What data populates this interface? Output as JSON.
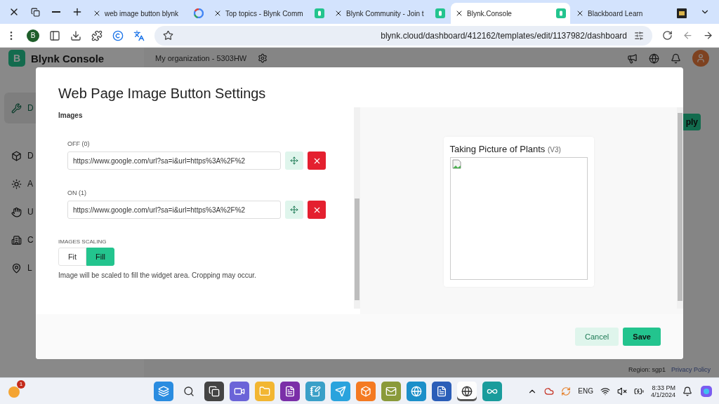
{
  "browser": {
    "tabs": [
      {
        "title": "web image button blynk",
        "selected": false
      },
      {
        "title": "Top topics - Blynk Comm",
        "selected": false
      },
      {
        "title": "Blynk Community - Join t",
        "selected": false
      },
      {
        "title": "Blynk.Console",
        "selected": true
      },
      {
        "title": "Blackboard Learn",
        "selected": false
      }
    ],
    "profile_initial": "B",
    "url": "blynk.cloud/dashboard/412162/templates/edit/1137982/dashboard"
  },
  "app": {
    "logo": "B",
    "name": "Blynk Console",
    "organization": "My organization - 5303HW",
    "sidebar": [
      {
        "label": "D",
        "selected": true
      },
      {
        "label": "D",
        "selected": false
      },
      {
        "label": "A",
        "selected": false
      },
      {
        "label": "U",
        "selected": false
      },
      {
        "label": "C",
        "selected": false
      },
      {
        "label": "L",
        "selected": false
      }
    ],
    "apply_button": "ply",
    "region": "Region: sgp1",
    "privacy": "Privacy Policy"
  },
  "dialog": {
    "title": "Web Page Image Button Settings",
    "section": "Images",
    "images": [
      {
        "label": "OFF (0)",
        "value": "https://www.google.com/url?sa=i&url=https%3A%2F%2"
      },
      {
        "label": "ON (1)",
        "value": "https://www.google.com/url?sa=i&url=https%3A%2F%2"
      }
    ],
    "scaling_label": "IMAGES SCALING",
    "scaling_options": [
      {
        "label": "Fit",
        "selected": false
      },
      {
        "label": "Fill",
        "selected": true
      }
    ],
    "hint": "Image will be scaled to fill the widget area. Cropping may occur.",
    "preview": {
      "title": "Taking Picture of Plants",
      "pin": "(V3)"
    },
    "buttons": [
      {
        "label": "Cancel",
        "kind": "secondary"
      },
      {
        "label": "Save",
        "kind": "primary"
      }
    ]
  },
  "taskbar": {
    "notification_count": "1",
    "apps": [
      {
        "kind": "start",
        "selected": false
      },
      {
        "kind": "search",
        "selected": false
      },
      {
        "kind": "taskview",
        "selected": false
      },
      {
        "kind": "meet",
        "selected": false
      },
      {
        "kind": "files",
        "selected": false
      },
      {
        "kind": "onenote",
        "selected": false
      },
      {
        "kind": "notepad",
        "selected": false
      },
      {
        "kind": "telegram",
        "selected": false
      },
      {
        "kind": "xampp",
        "selected": false
      },
      {
        "kind": "mail",
        "selected": false
      },
      {
        "kind": "edge",
        "selected": false
      },
      {
        "kind": "word",
        "selected": false
      },
      {
        "kind": "chrome",
        "selected": true
      },
      {
        "kind": "arduino",
        "selected": false
      }
    ],
    "language": "ENG",
    "time": "8:33 PM",
    "date": "4/1/2024"
  }
}
